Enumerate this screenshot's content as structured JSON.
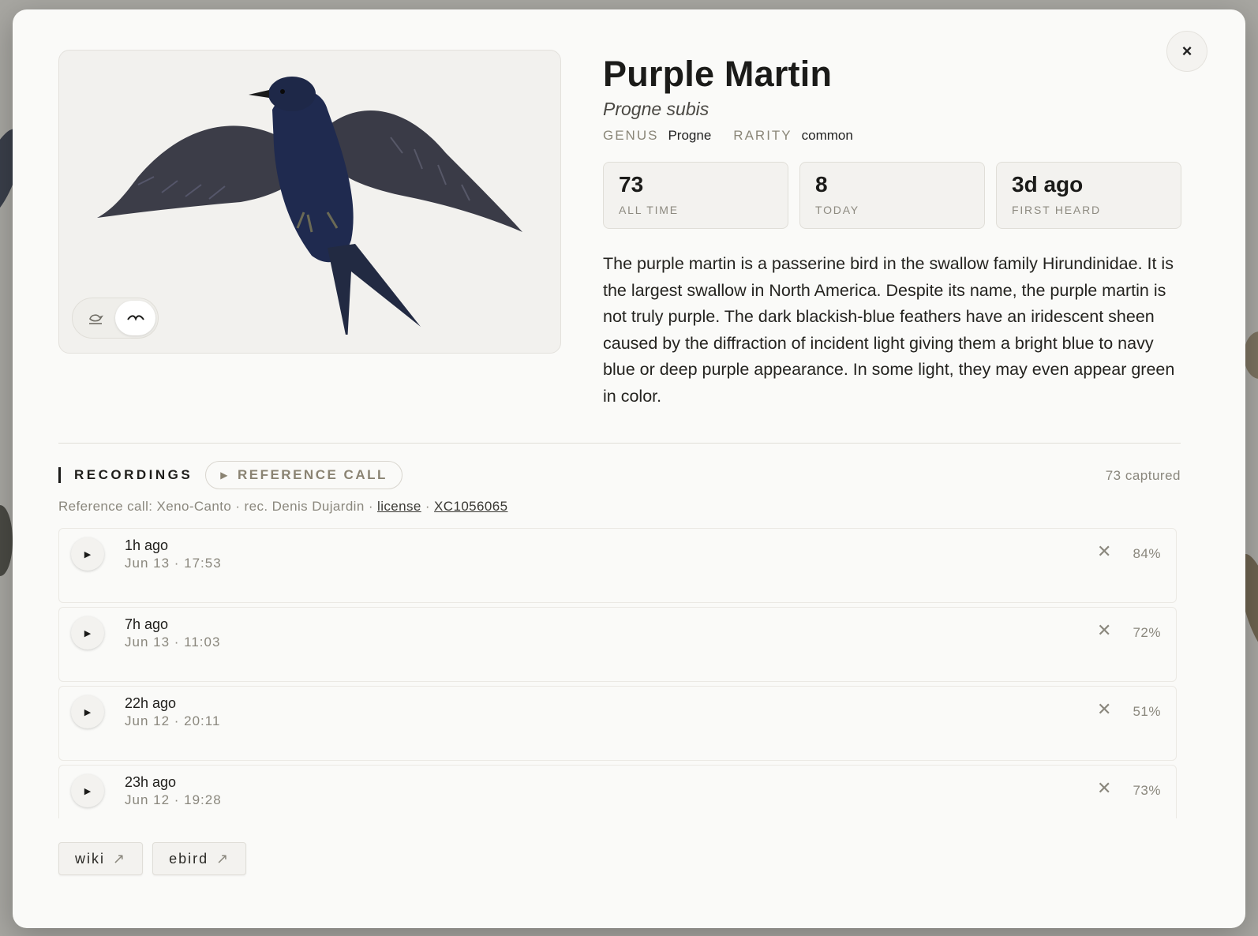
{
  "species": {
    "common_name": "Purple Martin",
    "scientific_name": "Progne subis",
    "genus_label": "GENUS",
    "genus": "Progne",
    "rarity_label": "RARITY",
    "rarity": "common"
  },
  "close_label": "×",
  "image_toggle": {
    "options": [
      "perched-bird-icon",
      "flying-bird-icon"
    ],
    "active": "flying-bird-icon"
  },
  "stats": [
    {
      "value": "73",
      "label": "ALL TIME"
    },
    {
      "value": "8",
      "label": "TODAY"
    },
    {
      "value": "3d ago",
      "label": "FIRST HEARD"
    }
  ],
  "description": "The purple martin is a passerine bird in the swallow family Hirundinidae. It is the largest swallow in North America. Despite its name, the purple martin is not truly purple. The dark blackish-blue feathers have an iridescent sheen caused by the diffraction of incident light giving them a bright blue to navy blue or deep purple appearance. In some light, they may even appear green in color.",
  "recordings": {
    "title": "RECORDINGS",
    "reference_button": "REFERENCE CALL",
    "captured": "73 captured",
    "credit_prefix": "Reference call: Xeno-Canto · rec. Denis Dujardin ·",
    "license_link": "license",
    "separator": "·",
    "xc_link": "XC1056065",
    "items": [
      {
        "ago": "1h ago",
        "when": "Jun 13 · 17:53",
        "confidence": "84%"
      },
      {
        "ago": "7h ago",
        "when": "Jun 13 · 11:03",
        "confidence": "72%"
      },
      {
        "ago": "22h ago",
        "when": "Jun 12 · 20:11",
        "confidence": "51%"
      },
      {
        "ago": "23h ago",
        "when": "Jun 12 · 19:28",
        "confidence": "73%"
      }
    ]
  },
  "links": [
    {
      "label": "wiki",
      "icon": "arrow-up-right-icon"
    },
    {
      "label": "ebird",
      "icon": "arrow-up-right-icon"
    }
  ],
  "colors": {
    "bird_body": "#1f2a4f",
    "bird_wing": "#3c3d48",
    "background": "#fafaf8"
  }
}
